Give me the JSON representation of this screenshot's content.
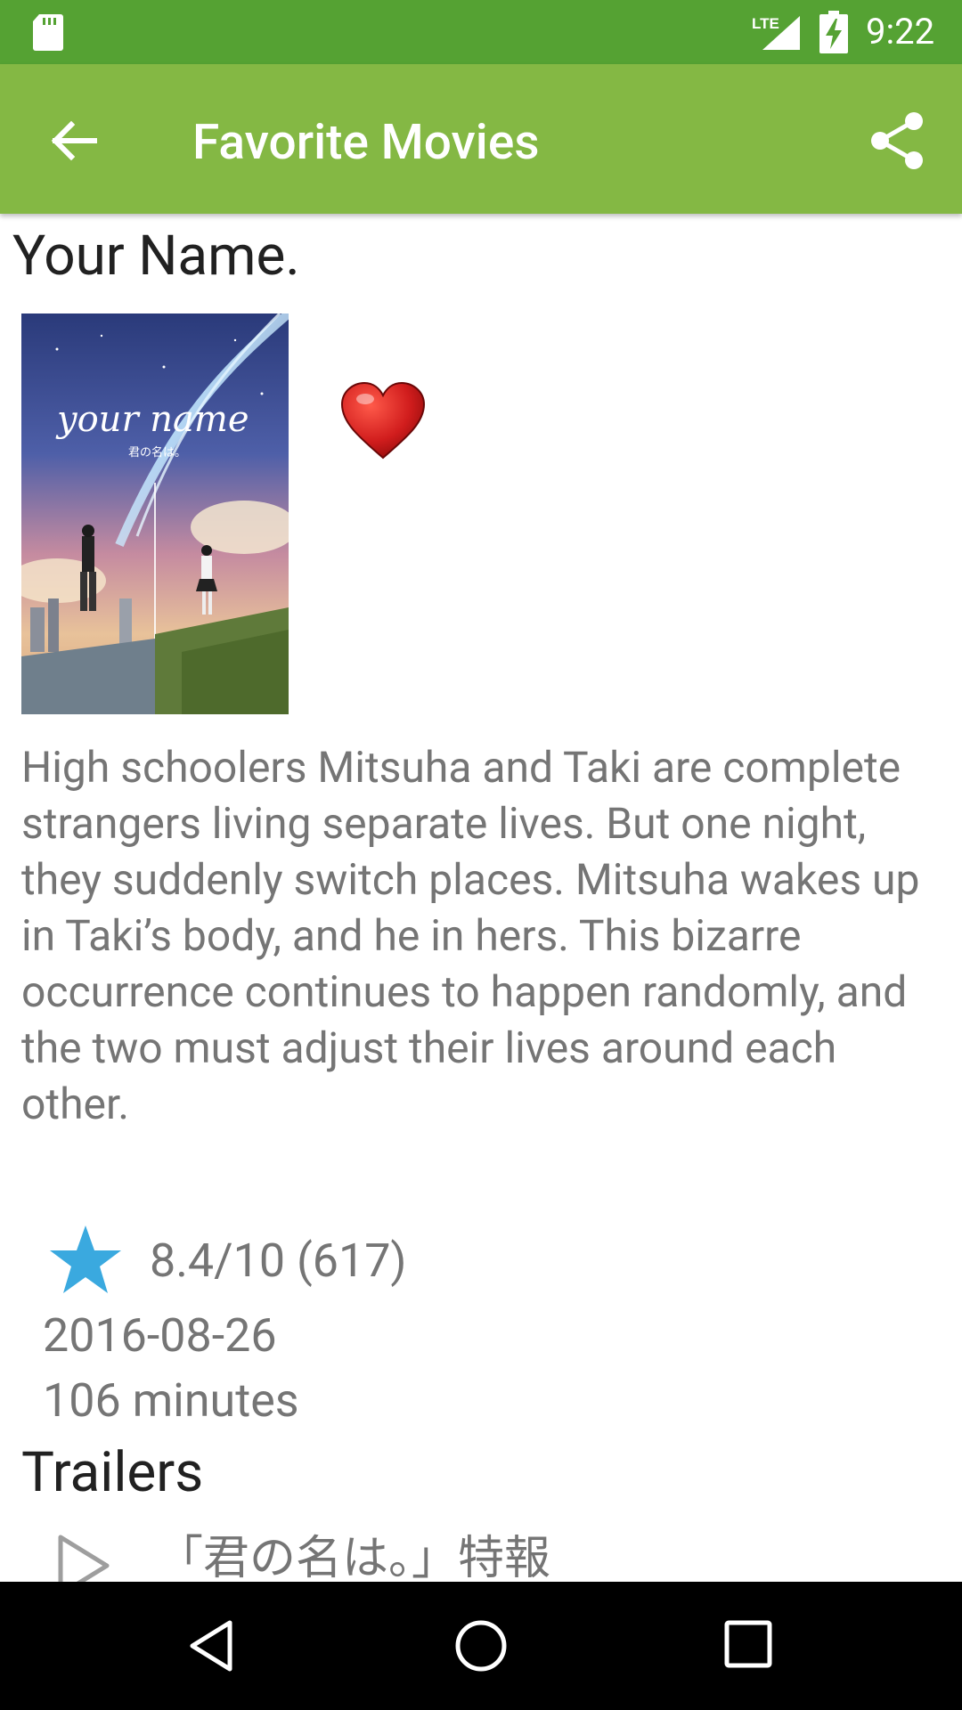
{
  "status_bar": {
    "time": "9:22",
    "network": "LTE",
    "icons": [
      "sd-card-icon",
      "lte-signal-icon",
      "battery-charging-icon"
    ]
  },
  "toolbar": {
    "title": "Favorite Movies",
    "back_icon": "arrow-back-icon",
    "share_icon": "share-icon"
  },
  "movie": {
    "title": "Your Name.",
    "poster_text": "your name",
    "poster_subtitle": "君の名は。",
    "favorite_icon": "heart-icon",
    "favorite": true,
    "overview": "High schoolers Mitsuha and Taki are complete strangers living separate lives. But one night, they suddenly switch places. Mitsuha wakes up in Taki’s body, and he in hers. This bizarre occurrence continues to happen randomly, and the two must adjust their lives around each other.",
    "rating_icon": "star-icon",
    "rating": "8.4/10 (617)",
    "release_date": "2016-08-26",
    "runtime": "106 minutes"
  },
  "trailers": {
    "heading": "Trailers",
    "items": [
      {
        "label": "「君の名は。」特報",
        "icon": "play-icon"
      }
    ]
  },
  "colors": {
    "status_bar": "#55a233",
    "toolbar": "#84b844",
    "heart": "#d11d1d",
    "star": "#3aa9df",
    "secondary_text": "#757575"
  }
}
